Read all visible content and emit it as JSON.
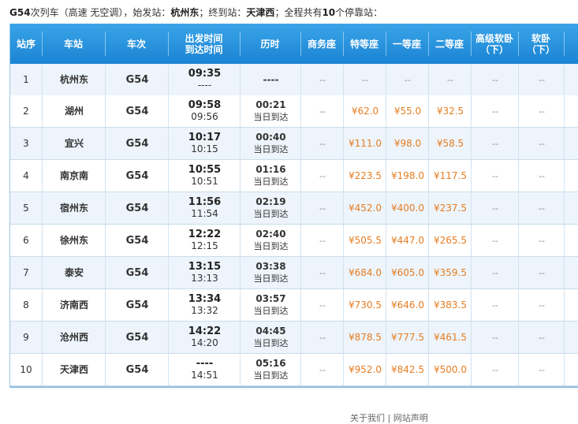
{
  "caption": {
    "train": "G54",
    "part1": "次列车（高速 无空调），始发站：",
    "origin": "杭州东",
    "part2": "；终到站：",
    "destination": "天津西",
    "part3": "；全程共有",
    "stop_count": "10",
    "part4": "个停靠站："
  },
  "headers": {
    "seq": "站序",
    "station": "车站",
    "train": "车次",
    "time_line1": "出发时间",
    "time_line2": "到达时间",
    "duration": "历时",
    "business": "商务座",
    "premium": "特等座",
    "first": "一等座",
    "second": "二等座",
    "soft_sleeper_line1": "高级软卧",
    "soft_sleeper_line2": "（下）",
    "sleeper_line1": "软卧",
    "sleeper_line2": "（下）"
  },
  "rows": [
    {
      "seq": "1",
      "station": "杭州东",
      "train": "G54",
      "depart": "09:35",
      "arrive": "----",
      "duration": "----",
      "day": "",
      "business": "--",
      "premium": "--",
      "first": "--",
      "second": "--",
      "soft": "--",
      "sleeper": "--"
    },
    {
      "seq": "2",
      "station": "湖州",
      "train": "G54",
      "depart": "09:58",
      "arrive": "09:56",
      "duration": "00:21",
      "day": "当日到达",
      "business": "--",
      "premium": "¥62.0",
      "first": "¥55.0",
      "second": "¥32.5",
      "soft": "--",
      "sleeper": "--"
    },
    {
      "seq": "3",
      "station": "宜兴",
      "train": "G54",
      "depart": "10:17",
      "arrive": "10:15",
      "duration": "00:40",
      "day": "当日到达",
      "business": "--",
      "premium": "¥111.0",
      "first": "¥98.0",
      "second": "¥58.5",
      "soft": "--",
      "sleeper": "--"
    },
    {
      "seq": "4",
      "station": "南京南",
      "train": "G54",
      "depart": "10:55",
      "arrive": "10:51",
      "duration": "01:16",
      "day": "当日到达",
      "business": "--",
      "premium": "¥223.5",
      "first": "¥198.0",
      "second": "¥117.5",
      "soft": "--",
      "sleeper": "--"
    },
    {
      "seq": "5",
      "station": "宿州东",
      "train": "G54",
      "depart": "11:56",
      "arrive": "11:54",
      "duration": "02:19",
      "day": "当日到达",
      "business": "--",
      "premium": "¥452.0",
      "first": "¥400.0",
      "second": "¥237.5",
      "soft": "--",
      "sleeper": "--"
    },
    {
      "seq": "6",
      "station": "徐州东",
      "train": "G54",
      "depart": "12:22",
      "arrive": "12:15",
      "duration": "02:40",
      "day": "当日到达",
      "business": "--",
      "premium": "¥505.5",
      "first": "¥447.0",
      "second": "¥265.5",
      "soft": "--",
      "sleeper": "--"
    },
    {
      "seq": "7",
      "station": "泰安",
      "train": "G54",
      "depart": "13:15",
      "arrive": "13:13",
      "duration": "03:38",
      "day": "当日到达",
      "business": "--",
      "premium": "¥684.0",
      "first": "¥605.0",
      "second": "¥359.5",
      "soft": "--",
      "sleeper": "--"
    },
    {
      "seq": "8",
      "station": "济南西",
      "train": "G54",
      "depart": "13:34",
      "arrive": "13:32",
      "duration": "03:57",
      "day": "当日到达",
      "business": "--",
      "premium": "¥730.5",
      "first": "¥646.0",
      "second": "¥383.5",
      "soft": "--",
      "sleeper": "--"
    },
    {
      "seq": "9",
      "station": "沧州西",
      "train": "G54",
      "depart": "14:22",
      "arrive": "14:20",
      "duration": "04:45",
      "day": "当日到达",
      "business": "--",
      "premium": "¥878.5",
      "first": "¥777.5",
      "second": "¥461.5",
      "soft": "--",
      "sleeper": "--"
    },
    {
      "seq": "10",
      "station": "天津西",
      "train": "G54",
      "depart": "----",
      "arrive": "14:51",
      "duration": "05:16",
      "day": "当日到达",
      "business": "--",
      "premium": "¥952.0",
      "first": "¥842.5",
      "second": "¥500.0",
      "soft": "--",
      "sleeper": "--"
    }
  ],
  "footer": {
    "text": "关于我们 | 网站声明"
  },
  "colors": {
    "header_bg": "#2395df",
    "price": "#e67e22",
    "row_alt": "#edf4fb"
  }
}
